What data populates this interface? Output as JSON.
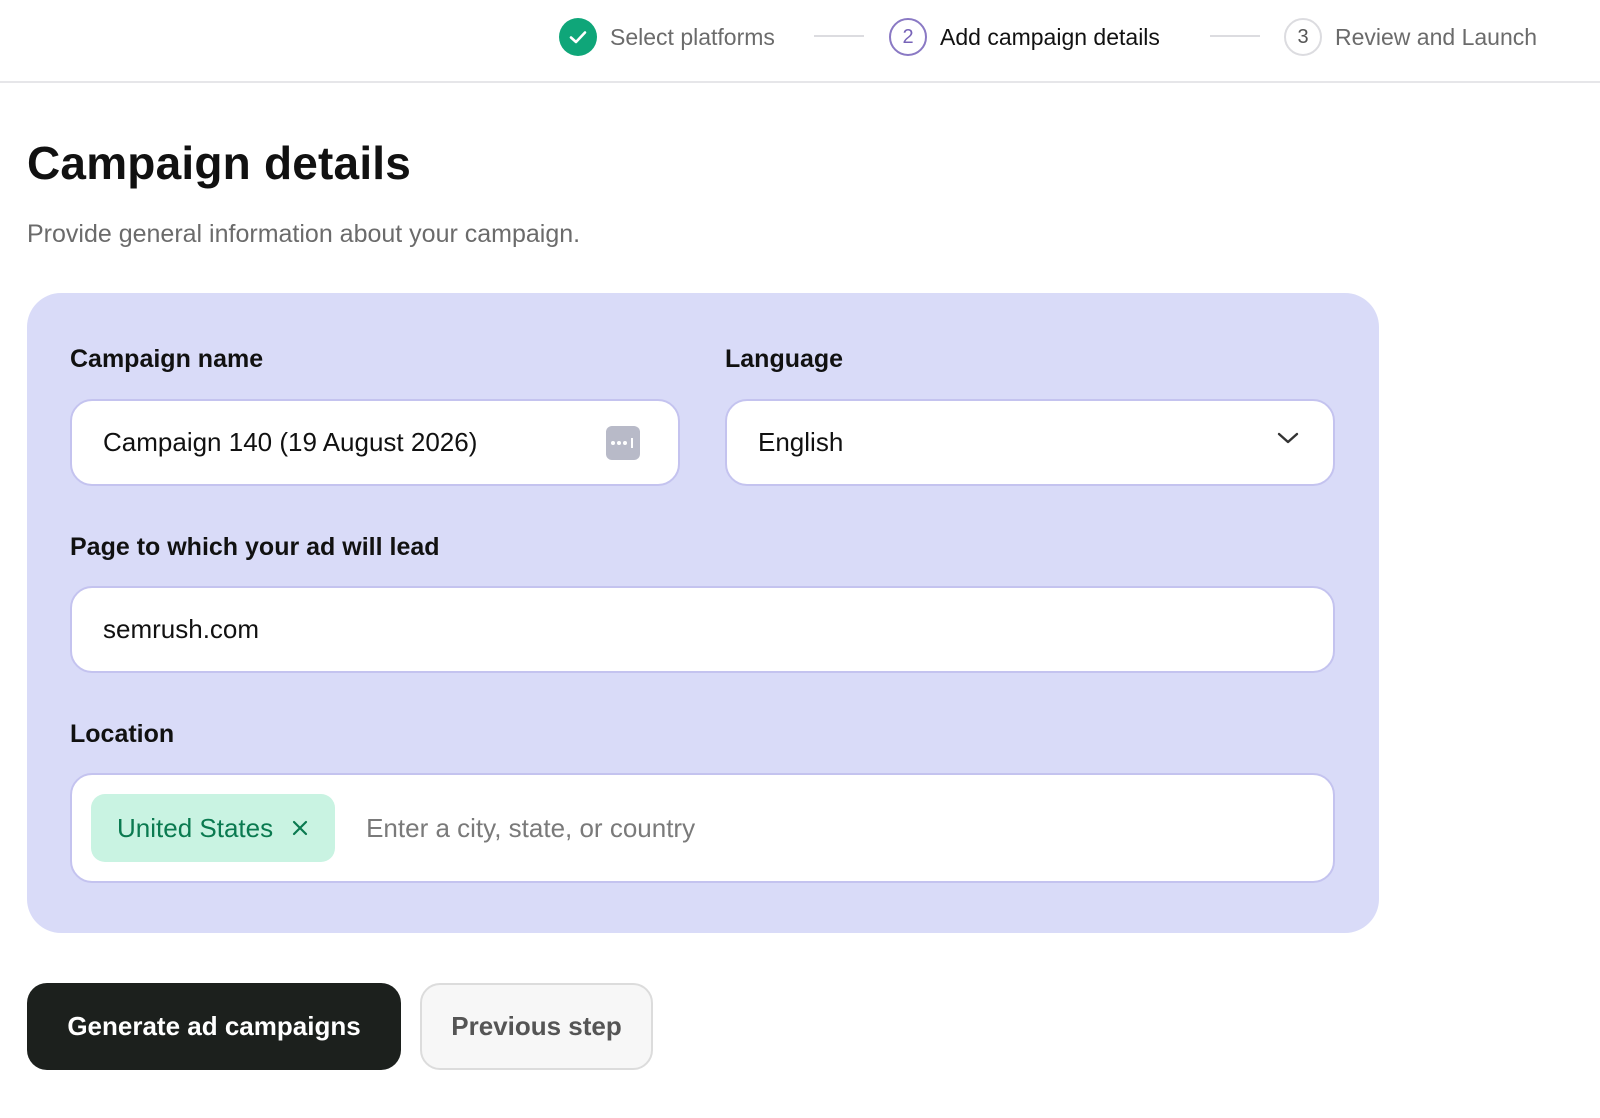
{
  "stepper": {
    "steps": [
      {
        "label": "Select platforms",
        "state": "done"
      },
      {
        "number": "2",
        "label": "Add campaign details",
        "state": "active"
      },
      {
        "number": "3",
        "label": "Review and Launch",
        "state": "pending"
      }
    ]
  },
  "header": {
    "title": "Campaign details",
    "subtitle": "Provide general information about your campaign."
  },
  "form": {
    "campaign_name": {
      "label": "Campaign name",
      "value": "Campaign 140 (19 August 2026)",
      "icon": "password-manager-icon"
    },
    "language": {
      "label": "Language",
      "value": "English",
      "icon": "chevron-down-icon"
    },
    "landing_page": {
      "label": "Page to which your ad will lead",
      "value": "semrush.com"
    },
    "location": {
      "label": "Location",
      "chips": [
        {
          "label": "United States"
        }
      ],
      "placeholder": "Enter a city, state, or country"
    }
  },
  "actions": {
    "primary_label": "Generate ad campaigns",
    "secondary_label": "Previous step"
  },
  "colors": {
    "accent_done": "#0fa679",
    "accent_active": "#7763b8",
    "panel_bg": "#d9dbf8",
    "chip_bg": "#c9f3e2",
    "chip_text": "#0a7a50",
    "primary_button": "#1c201d"
  }
}
